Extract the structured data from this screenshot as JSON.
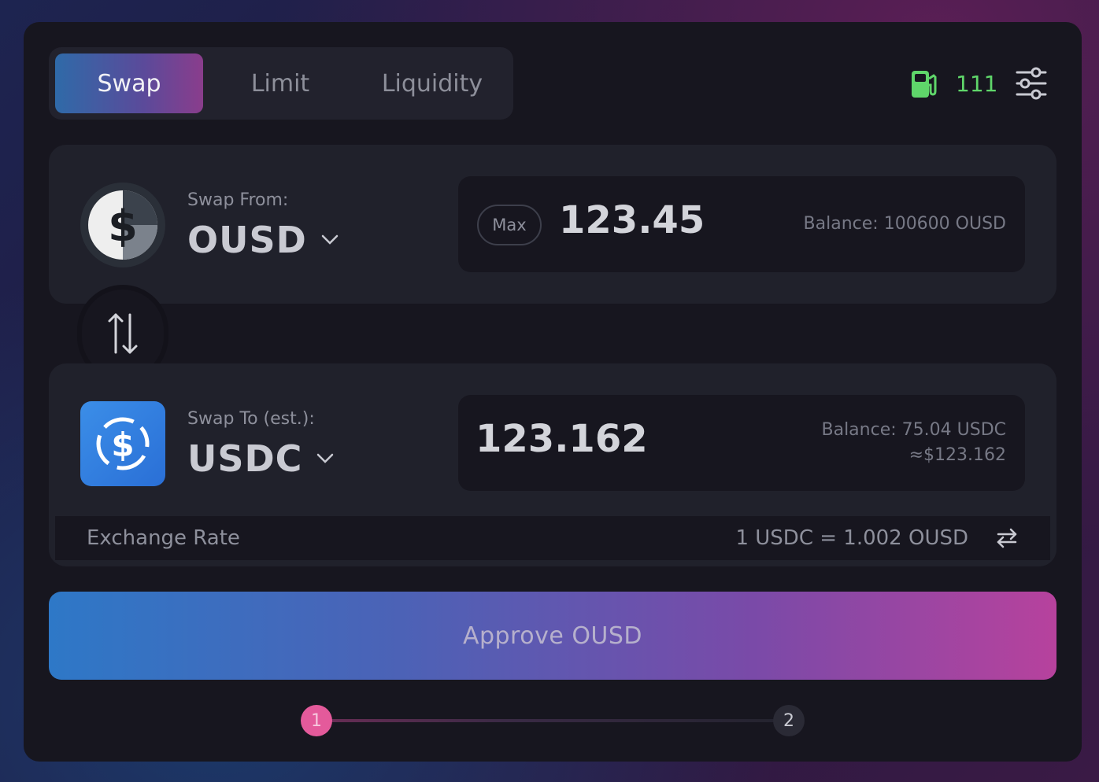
{
  "tabs": [
    {
      "label": "Swap",
      "active": true
    },
    {
      "label": "Limit",
      "active": false
    },
    {
      "label": "Liquidity",
      "active": false
    }
  ],
  "gas": {
    "icon": "gas-pump-icon",
    "value": "111",
    "color": "#5fd66a"
  },
  "settings": {
    "icon": "sliders-icon"
  },
  "from": {
    "label": "Swap From:",
    "token": "OUSD",
    "token_icon": "ousd-dollar-icon",
    "max_label": "Max",
    "amount": "123.45",
    "balance": "Balance: 100600 OUSD"
  },
  "switch": {
    "icon": "swap-direction-icon"
  },
  "to": {
    "label": "Swap To (est.):",
    "token": "USDC",
    "token_icon": "usdc-dollar-icon",
    "amount": "123.162",
    "balance": "Balance: 75.04 USDC",
    "usd_value": "≈$123.162"
  },
  "rate": {
    "label": "Exchange Rate",
    "value": "1 USDC = 1.002 OUSD",
    "toggle_icon": "switch-arrows-icon"
  },
  "approve": {
    "label": "Approve OUSD"
  },
  "steps": [
    "1",
    "2"
  ],
  "colors": {
    "accent_start": "#2e78c7",
    "accent_end": "#b7429d",
    "step_active": "#e45a9b"
  }
}
